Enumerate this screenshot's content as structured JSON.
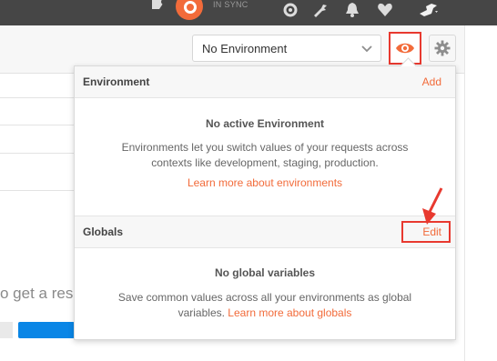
{
  "header": {
    "sync_status": "IN SYNC",
    "icons": [
      "plugin-icon",
      "sync-icon",
      "satellite-icon",
      "wrench-icon",
      "bell-icon",
      "heart-icon",
      "twitter-icon"
    ]
  },
  "environment": {
    "selected": "No Environment",
    "eye_tooltip_icon": "eye-icon",
    "settings_icon": "gear-icon"
  },
  "panel": {
    "env_section": {
      "title": "Environment",
      "action": "Add",
      "empty_title": "No active Environment",
      "empty_body": "Environments let you switch values of your requests across contexts like development, staging, production.",
      "link": "Learn more about environments"
    },
    "globals_section": {
      "title": "Globals",
      "action": "Edit",
      "empty_title": "No global variables",
      "empty_body": "Save common values across all your environments as global variables.",
      "link": "Learn more about globals"
    }
  },
  "left": {
    "partial_text": "o get a res"
  },
  "colors": {
    "accent": "#f26b3a",
    "highlight": "#e8392f",
    "header_bg": "#464646",
    "primary_button": "#0a86e6"
  }
}
